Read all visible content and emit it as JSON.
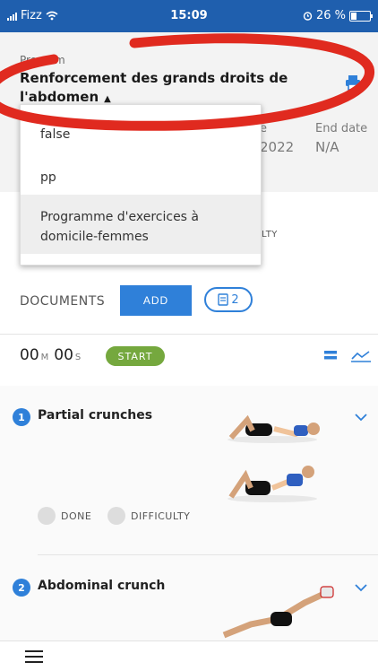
{
  "status_bar": {
    "carrier": "Fizz",
    "time": "15:09",
    "battery": "26 %",
    "battery_level": 0.26
  },
  "program": {
    "label": "Program",
    "title": "Renforcement des grands droits de l'abdomen",
    "caret": "▲",
    "end_date_label": "End date",
    "end_date_value": "N/A",
    "start_label_fragment": "e",
    "start_value_fragment": "2022"
  },
  "dropdown": {
    "options": [
      "false",
      "pp",
      "Programme d'exercices à domicile-femmes"
    ]
  },
  "difficulty_fragment": "LTY",
  "documents": {
    "label": "DOCUMENTS",
    "add_label": "ADD",
    "count": "2"
  },
  "timer": {
    "minutes": "00",
    "minutes_unit": "M",
    "seconds": "00",
    "seconds_unit": "S",
    "start_label": "START"
  },
  "exercises": [
    {
      "number": "1",
      "name": "Partial crunches",
      "done_label": "DONE",
      "difficulty_label": "DIFFICULTY"
    },
    {
      "number": "2",
      "name": "Abdominal crunch"
    }
  ],
  "colors": {
    "status_bar": "#1f5fae",
    "accent": "#2f80d9",
    "start": "#75a83e",
    "annotation": "#e02a1f"
  },
  "icons": [
    "wifi-icon",
    "alarm-icon",
    "print-icon",
    "document-icon",
    "list-view-icon",
    "chart-icon",
    "chevron-down-icon",
    "menu-icon"
  ]
}
